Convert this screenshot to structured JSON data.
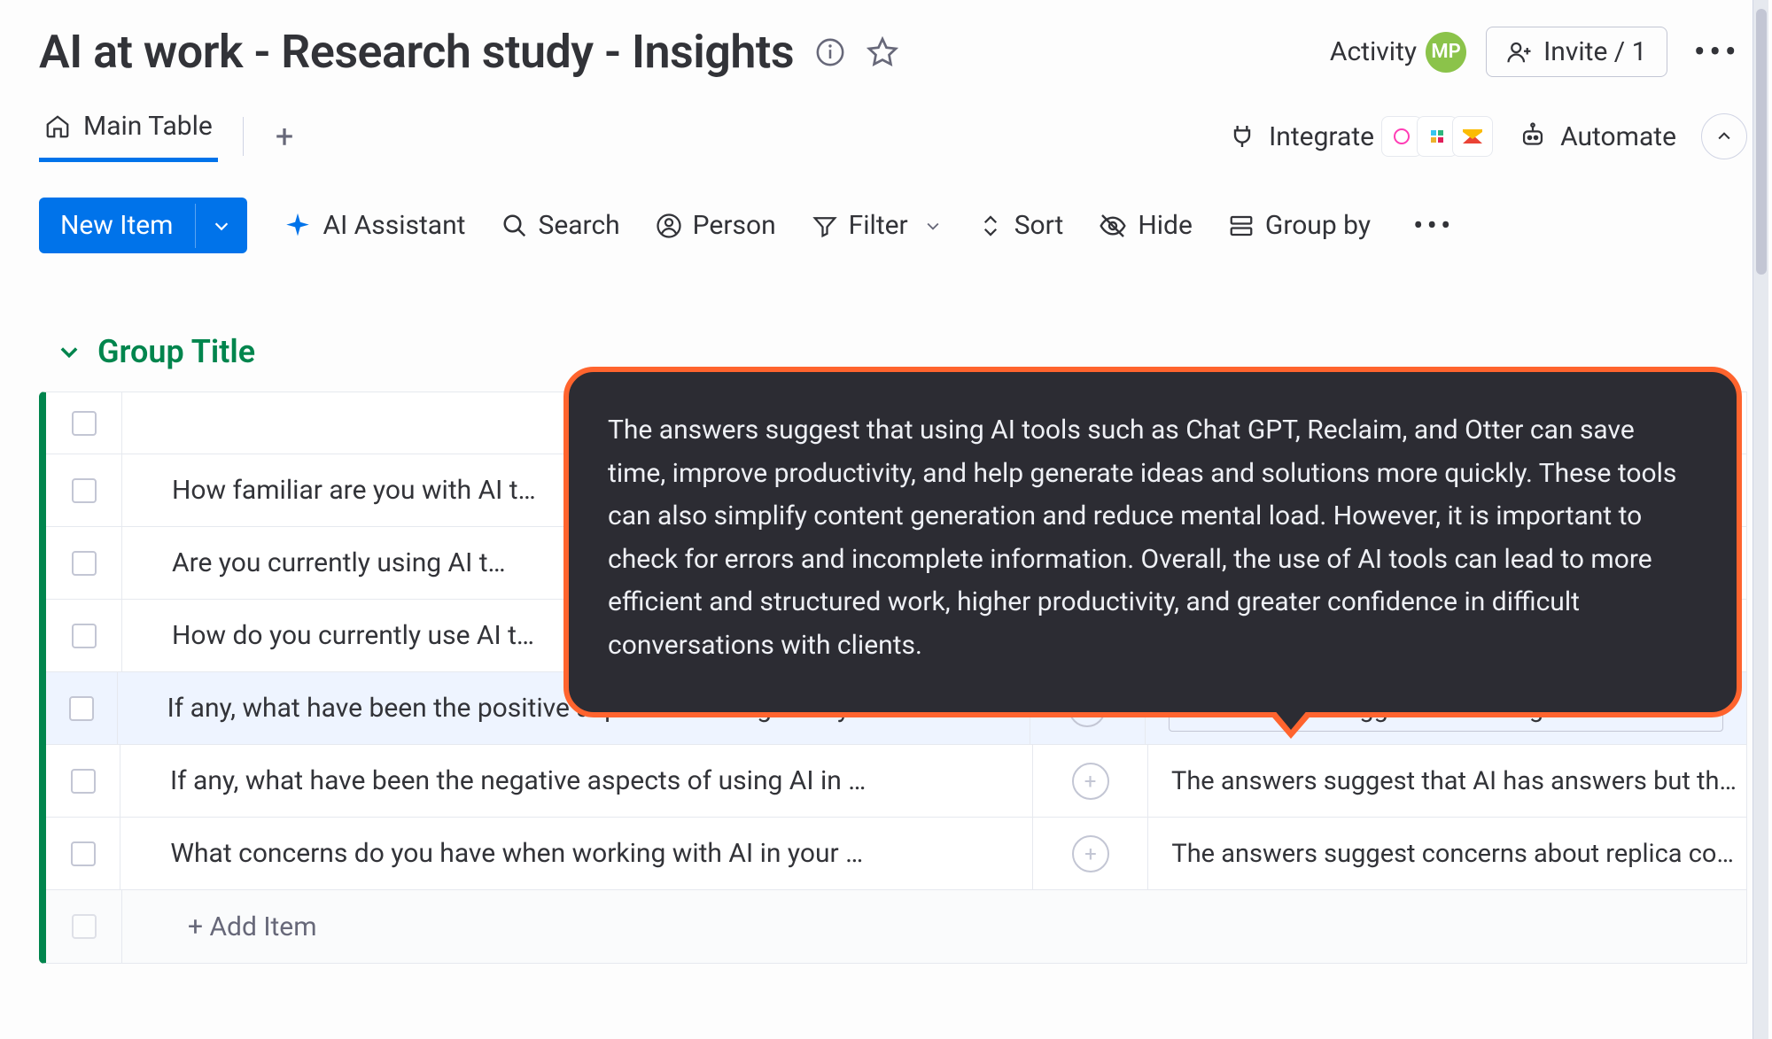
{
  "header": {
    "title": "AI at work - Research study - Insights",
    "activity_label": "Activity",
    "avatar_initials": "MP",
    "invite_label": "Invite / 1"
  },
  "tabs": {
    "main_tab_label": "Main Table",
    "integrate_label": "Integrate",
    "automate_label": "Automate"
  },
  "toolbar": {
    "new_item_label": "New Item",
    "ai_assistant_label": "AI Assistant",
    "search_label": "Search",
    "person_label": "Person",
    "filter_label": "Filter",
    "sort_label": "Sort",
    "hide_label": "Hide",
    "group_by_label": "Group by"
  },
  "group": {
    "title": "Group Title",
    "add_item_label": "+ Add Item"
  },
  "rows": [
    {
      "name": "How familiar are you with AI t…",
      "answer": ""
    },
    {
      "name": "Are you currently using AI t…",
      "answer": ""
    },
    {
      "name": "How do you currently use AI t…",
      "answer": ""
    },
    {
      "name": "If any, what have been the positive aspects of using AI in y…",
      "answer": "The answers suggest that using AI tools such as…",
      "selected": true
    },
    {
      "name": "If any, what have been the negative aspects of using AI in …",
      "answer": "The answers suggest that AI has answers but th…"
    },
    {
      "name": "What concerns do you have when working with AI in your …",
      "answer": "The answers suggest concerns about replica co…"
    }
  ],
  "tooltip": {
    "text": "The answers suggest that using AI tools such as Chat GPT, Reclaim, and Otter can save time, improve productivity, and help generate ideas and solutions more quickly. These tools can also simplify content generation and reduce mental load. However, it is important to check for errors and incomplete information. Overall, the use of AI tools can lead to more efficient and structured work, higher productivity, and greater confidence in difficult conversations with clients."
  },
  "colors": {
    "primary": "#0073ea",
    "group_accent": "#00854d",
    "highlight_border": "#ff642e"
  }
}
